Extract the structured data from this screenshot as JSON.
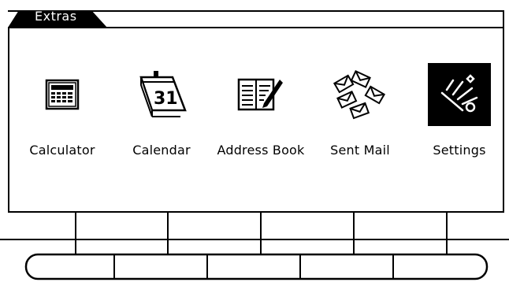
{
  "window": {
    "title": "Extras"
  },
  "apps": [
    {
      "label": "Calculator",
      "icon": "calculator-icon",
      "selected": false
    },
    {
      "label": "Calendar",
      "icon": "calendar-icon",
      "day": "31",
      "selected": false
    },
    {
      "label": "Address Book",
      "icon": "address-book-icon",
      "selected": false
    },
    {
      "label": "Sent Mail",
      "icon": "sent-mail-icon",
      "selected": false
    },
    {
      "label": "Settings",
      "icon": "settings-icon",
      "selected": true
    }
  ],
  "colors": {
    "foreground": "#000000",
    "background": "#ffffff"
  }
}
